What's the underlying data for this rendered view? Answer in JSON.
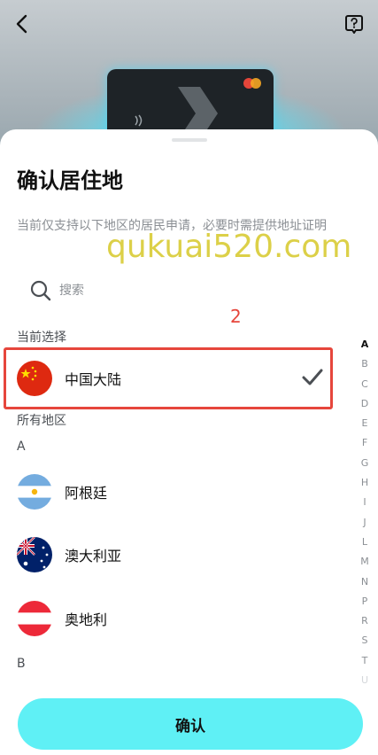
{
  "header": {
    "back_icon": "chevron-left-icon",
    "help_icon": "help-square-icon"
  },
  "sheet": {
    "title": "确认居住地",
    "description": "当前仅支持以下地区的居民申请，必要时需提供地址证明",
    "search_placeholder": "搜索",
    "current_label": "当前选择",
    "annotation_number": "2",
    "current_selection": {
      "name": "中国大陆",
      "flag": "china"
    },
    "all_label": "所有地区",
    "groups": [
      {
        "letter": "A",
        "items": [
          {
            "name": "阿根廷",
            "flag": "argentina"
          },
          {
            "name": "澳大利亚",
            "flag": "australia"
          },
          {
            "name": "奥地利",
            "flag": "austria"
          }
        ]
      },
      {
        "letter": "B",
        "items": []
      }
    ],
    "index_letters": [
      "A",
      "B",
      "C",
      "D",
      "E",
      "F",
      "G",
      "H",
      "I",
      "J",
      "L",
      "M",
      "N",
      "P",
      "R",
      "S",
      "T",
      "U"
    ],
    "active_index": "A",
    "confirm_label": "确认"
  },
  "watermark": "qukuai520.com",
  "colors": {
    "accent": "#5ff0f5",
    "annotation": "#e6463c",
    "muted_text": "#8b8f94"
  }
}
